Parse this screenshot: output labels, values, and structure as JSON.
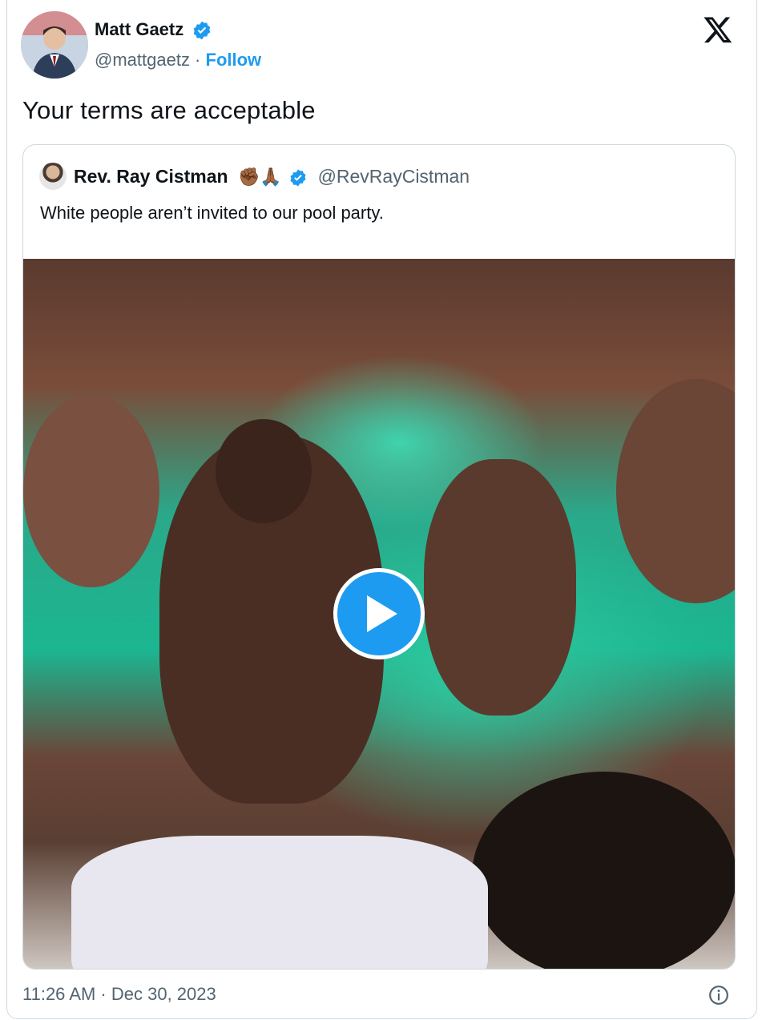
{
  "tweet": {
    "author": {
      "name": "Matt Gaetz",
      "handle": "@mattgaetz",
      "separator": " · ",
      "follow_label": "Follow",
      "verified_icon": "verified-badge-icon"
    },
    "text": "Your terms are acceptable",
    "logo_icon": "x-logo-icon",
    "timestamp": "11:26 AM · Dec 30, 2023",
    "info_icon": "info-icon"
  },
  "quote": {
    "author": {
      "name": "Rev. Ray Cistman",
      "emoji": "✊🏾🙏🏾",
      "handle": "@RevRayCistman"
    },
    "text": "White people aren’t invited to our pool party.",
    "media": {
      "type": "video",
      "play_icon": "play-icon"
    }
  },
  "colors": {
    "accent": "#1d9bf0",
    "secondary_text": "#536471",
    "border": "#cfd9de"
  }
}
